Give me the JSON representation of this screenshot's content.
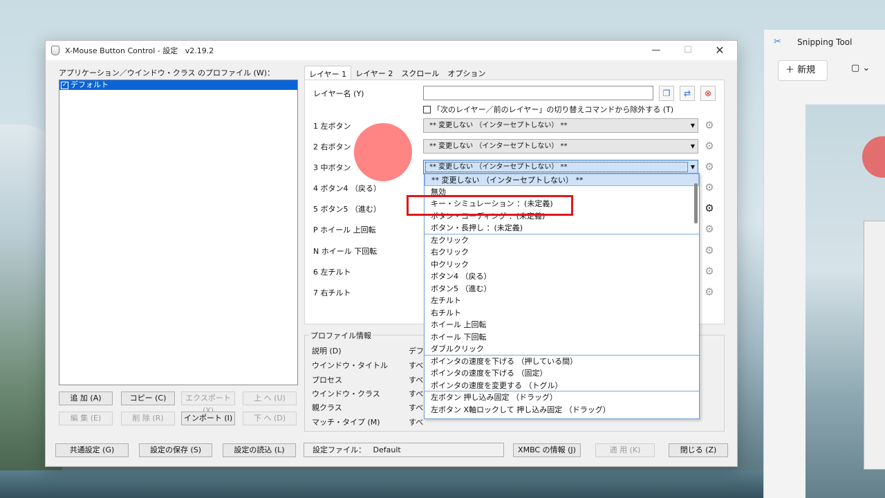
{
  "window": {
    "title": "X-Mouse Button Control - 設定",
    "version": "v2.19.2",
    "min": "—",
    "max": "☐",
    "close": "✕"
  },
  "left": {
    "label": "アプリケーション／ウインドウ・クラス のプロファイル (W)：",
    "profiles": [
      "デフォルト"
    ],
    "buttons": {
      "add": "追 加 (A)",
      "copy": "コピー (C)",
      "export": "エクスポート (X)",
      "up": "上 へ (U)",
      "edit": "編 集 (E)",
      "delete": "削 除 (R)",
      "import": "インポート (I)",
      "down": "下 へ (D)"
    }
  },
  "tabs": [
    "レイヤー 1",
    "レイヤー 2",
    "スクロール",
    "オプション"
  ],
  "layer": {
    "name_label": "レイヤー名 (Y)",
    "name_value": "",
    "exclude_label": "「次のレイヤー／前のレイヤー」の切り替えコマンドから除外する (T)",
    "rows": [
      {
        "label": "1 左ボタン",
        "value": "** 変更しない （インターセプトしない） **"
      },
      {
        "label": "2 右ボタン",
        "value": "** 変更しない （インターセプトしない） **"
      },
      {
        "label": "3 中ボタン",
        "value": "** 変更しない （インターセプトしない） **"
      },
      {
        "label": "4 ボタン4 （戻る）"
      },
      {
        "label": "5 ボタン5 （進む）"
      },
      {
        "label": "P ホイール 上回転"
      },
      {
        "label": "N ホイール 下回転"
      },
      {
        "label": "6 左チルト"
      },
      {
        "label": "7 右チルト"
      }
    ],
    "gear_icon": "⚙"
  },
  "dropdown": {
    "items": [
      "** 変更しない （インターセプトしない） **",
      "無効",
      "キー・シミュレーション ：(未定義)",
      "ボタン・コーディング ：(未定義)",
      "ボタン・長押し ：(未定義)",
      "左クリック",
      "右クリック",
      "中クリック",
      "ボタン4 （戻る）",
      "ボタン5 （進む）",
      "左チルト",
      "右チルト",
      "ホイール 上回転",
      "ホイール 下回転",
      "ダブルクリック",
      "ポインタの速度を下げる （押している間）",
      "ポインタの速度を下げる （固定）",
      "ポインタの速度を変更する （トグル）",
      "左ボタン 押し込み固定 （ドラッグ）",
      "左ボタン X軸ロックして 押し込み固定 （ドラッグ）"
    ]
  },
  "info": {
    "legend": "プロファイル情報",
    "rows": [
      {
        "label": "説明 (D)",
        "value": "デフ"
      },
      {
        "label": "ウインドウ・タイトル",
        "value": "すべ"
      },
      {
        "label": "プロセス",
        "value": "すべ"
      },
      {
        "label": "ウインドウ・クラス",
        "value": "すべ"
      },
      {
        "label": "親クラス",
        "value": "すべ"
      },
      {
        "label": "マッチ・タイプ (M)",
        "value": "すべ"
      }
    ]
  },
  "bottom": {
    "common": "共通設定 (G)",
    "save": "設定の保存 (S)",
    "load": "設定の読込 (L)",
    "settings_file_label": "設定ファイル：",
    "settings_file_value": "Default",
    "about": "XMBC の情報 (J)",
    "apply": "適 用 (K)",
    "close": "閉じる (Z)"
  },
  "snipping": {
    "title": "Snipping Tool",
    "new": "＋ 新規"
  },
  "colors": {
    "highlight": "#e0161b",
    "selection": "#0a64d6"
  }
}
